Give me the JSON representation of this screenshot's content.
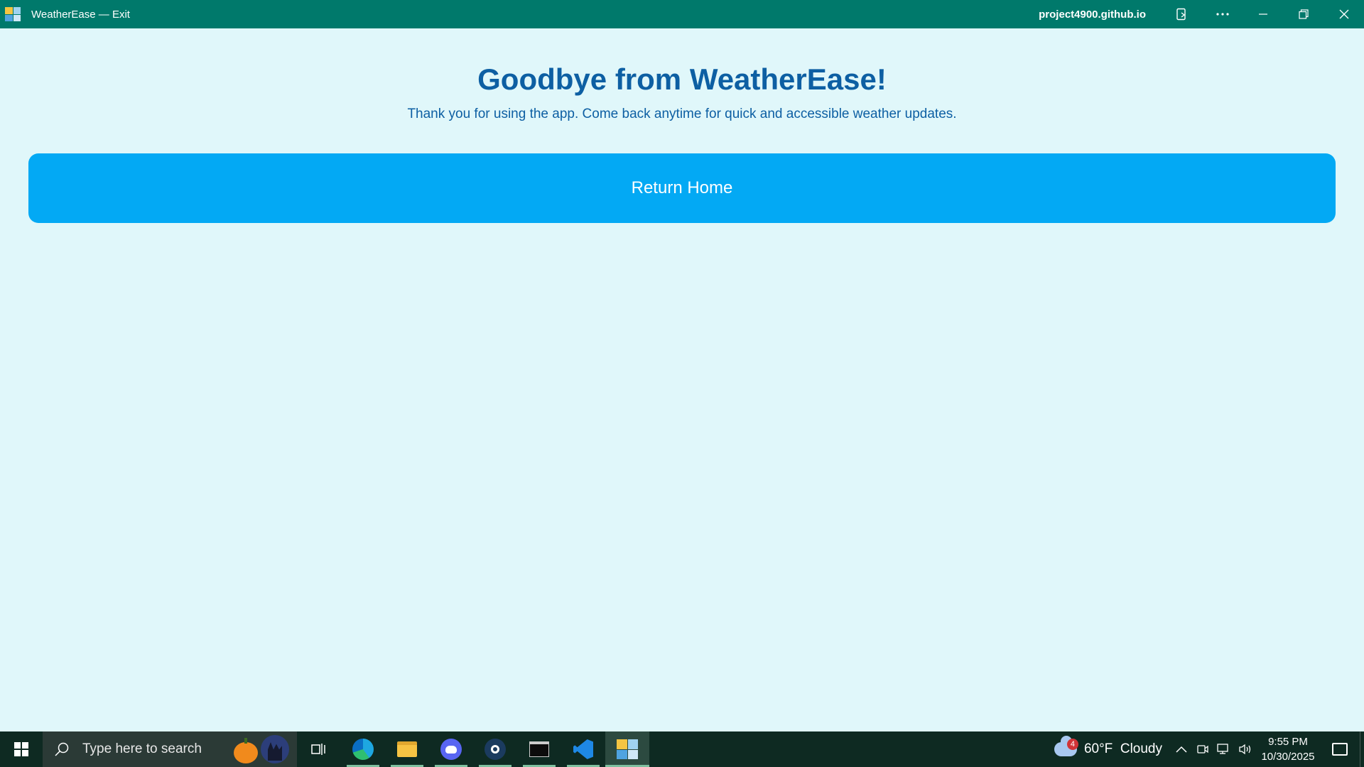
{
  "window": {
    "title": "WeatherEase — Exit",
    "domain": "project4900.github.io",
    "app_icon": "weatherease-app-icon",
    "buttons": {
      "app_options_icon": "app-options-icon",
      "more_icon": "more-icon",
      "minimize_icon": "minimize-icon",
      "restore_icon": "restore-icon",
      "close_icon": "close-icon"
    }
  },
  "main": {
    "heading": "Goodbye from WeatherEase!",
    "subheading": "Thank you for using the app. Come back anytime for quick and accessible weather updates.",
    "return_button": "Return Home"
  },
  "taskbar": {
    "search_placeholder": "Type here to search",
    "apps": [
      {
        "name": "task-view",
        "icon": "task-view-icon"
      },
      {
        "name": "edge",
        "icon": "edge-icon",
        "running": true
      },
      {
        "name": "file-explorer",
        "icon": "folder-icon",
        "running": true
      },
      {
        "name": "discord",
        "icon": "discord-icon",
        "running": true
      },
      {
        "name": "steam",
        "icon": "steam-icon",
        "running": true
      },
      {
        "name": "terminal",
        "icon": "terminal-icon",
        "running": true
      },
      {
        "name": "vscode",
        "icon": "vscode-icon",
        "running": true
      },
      {
        "name": "weatherease",
        "icon": "weatherease-icon",
        "running": true,
        "active": true
      }
    ],
    "weather": {
      "badge": "4",
      "text": "60°F  Cloudy"
    },
    "clock": {
      "time": "9:55 PM",
      "date": "10/30/2025"
    }
  },
  "colors": {
    "titlebar": "#00796b",
    "page_background": "#e0f7fa",
    "heading": "#0d5fa3",
    "button": "#03a9f4",
    "taskbar": "#0e2a22"
  }
}
